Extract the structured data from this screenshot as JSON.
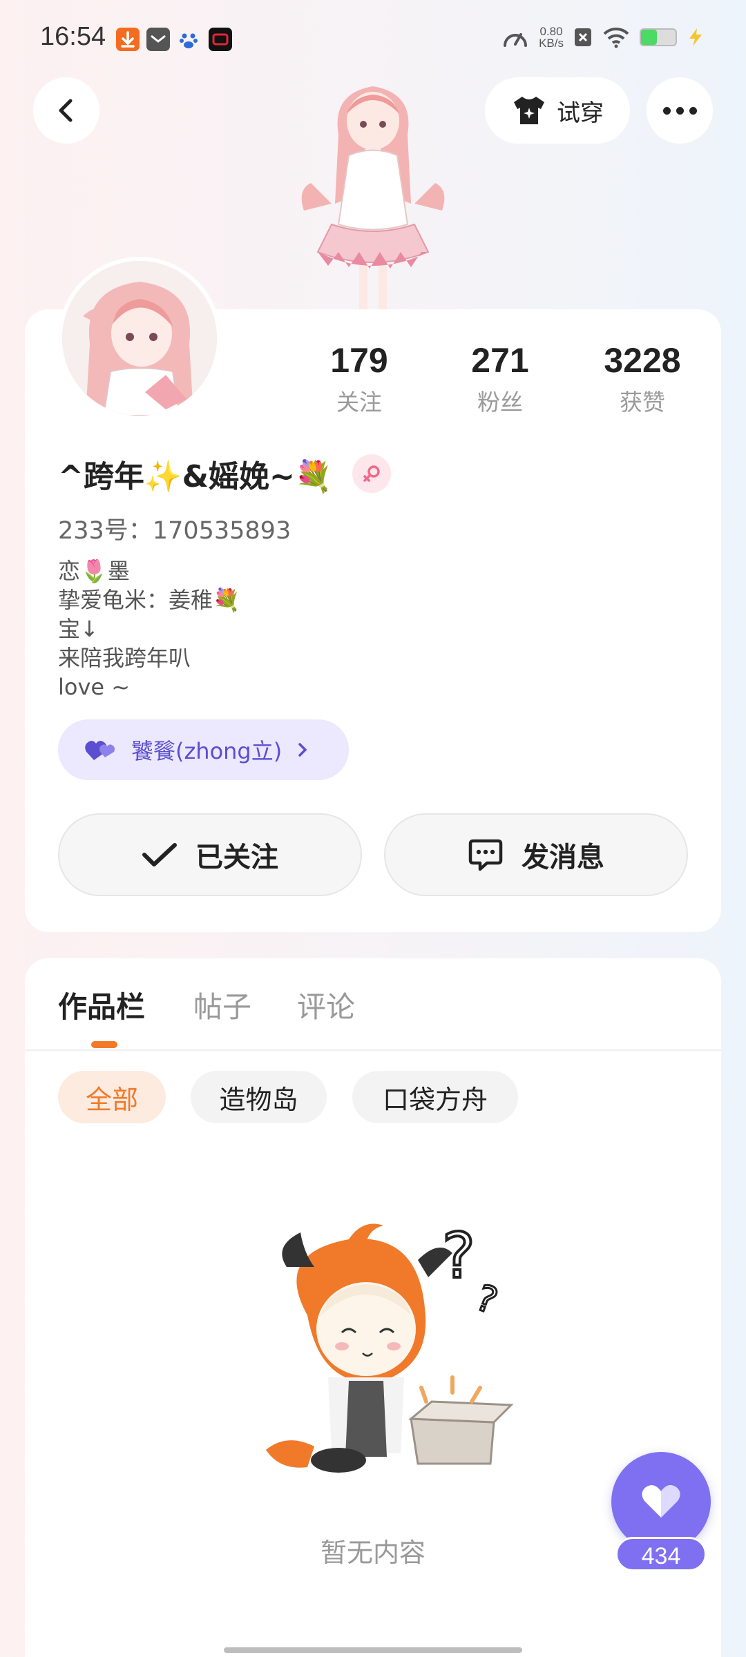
{
  "status_bar": {
    "time": "16:54",
    "net_speed_value": "0.80",
    "net_speed_unit": "KB/s",
    "battery_level": 0.45,
    "colors": {
      "download": "#f36c21",
      "mail": "#555555",
      "baidu": "#2f6bd8",
      "recorder": "#e0263a"
    }
  },
  "header": {
    "try_on_label": "试穿",
    "icons": [
      "back-arrow-icon",
      "tshirt-sparkle-icon",
      "more-icon"
    ]
  },
  "profile": {
    "stats": [
      {
        "num": "179",
        "label": "关注"
      },
      {
        "num": "271",
        "label": "粉丝"
      },
      {
        "num": "3228",
        "label": "获赞"
      }
    ],
    "nickname": "^跨年✨&媱娩~💐",
    "gender": "female",
    "uid": "233号：170535893",
    "bio_lines": [
      "恋🌷墨",
      "挚爱龟米：姜稚💐",
      "宝↓",
      "来陪我跨年叭",
      "love ~"
    ],
    "cp_label": "饕餮(zhong立)",
    "follow_label": "已关注",
    "message_label": "发消息"
  },
  "works": {
    "tabs": [
      "作品栏",
      "帖子",
      "评论"
    ],
    "active_tab": 0,
    "chips": [
      "全部",
      "造物岛",
      "口袋方舟"
    ],
    "active_chip": 0,
    "empty_text": "暂无内容"
  },
  "like_fab": {
    "count": "434",
    "color": "#7e70f0"
  },
  "accent_color": "#f07a2a"
}
